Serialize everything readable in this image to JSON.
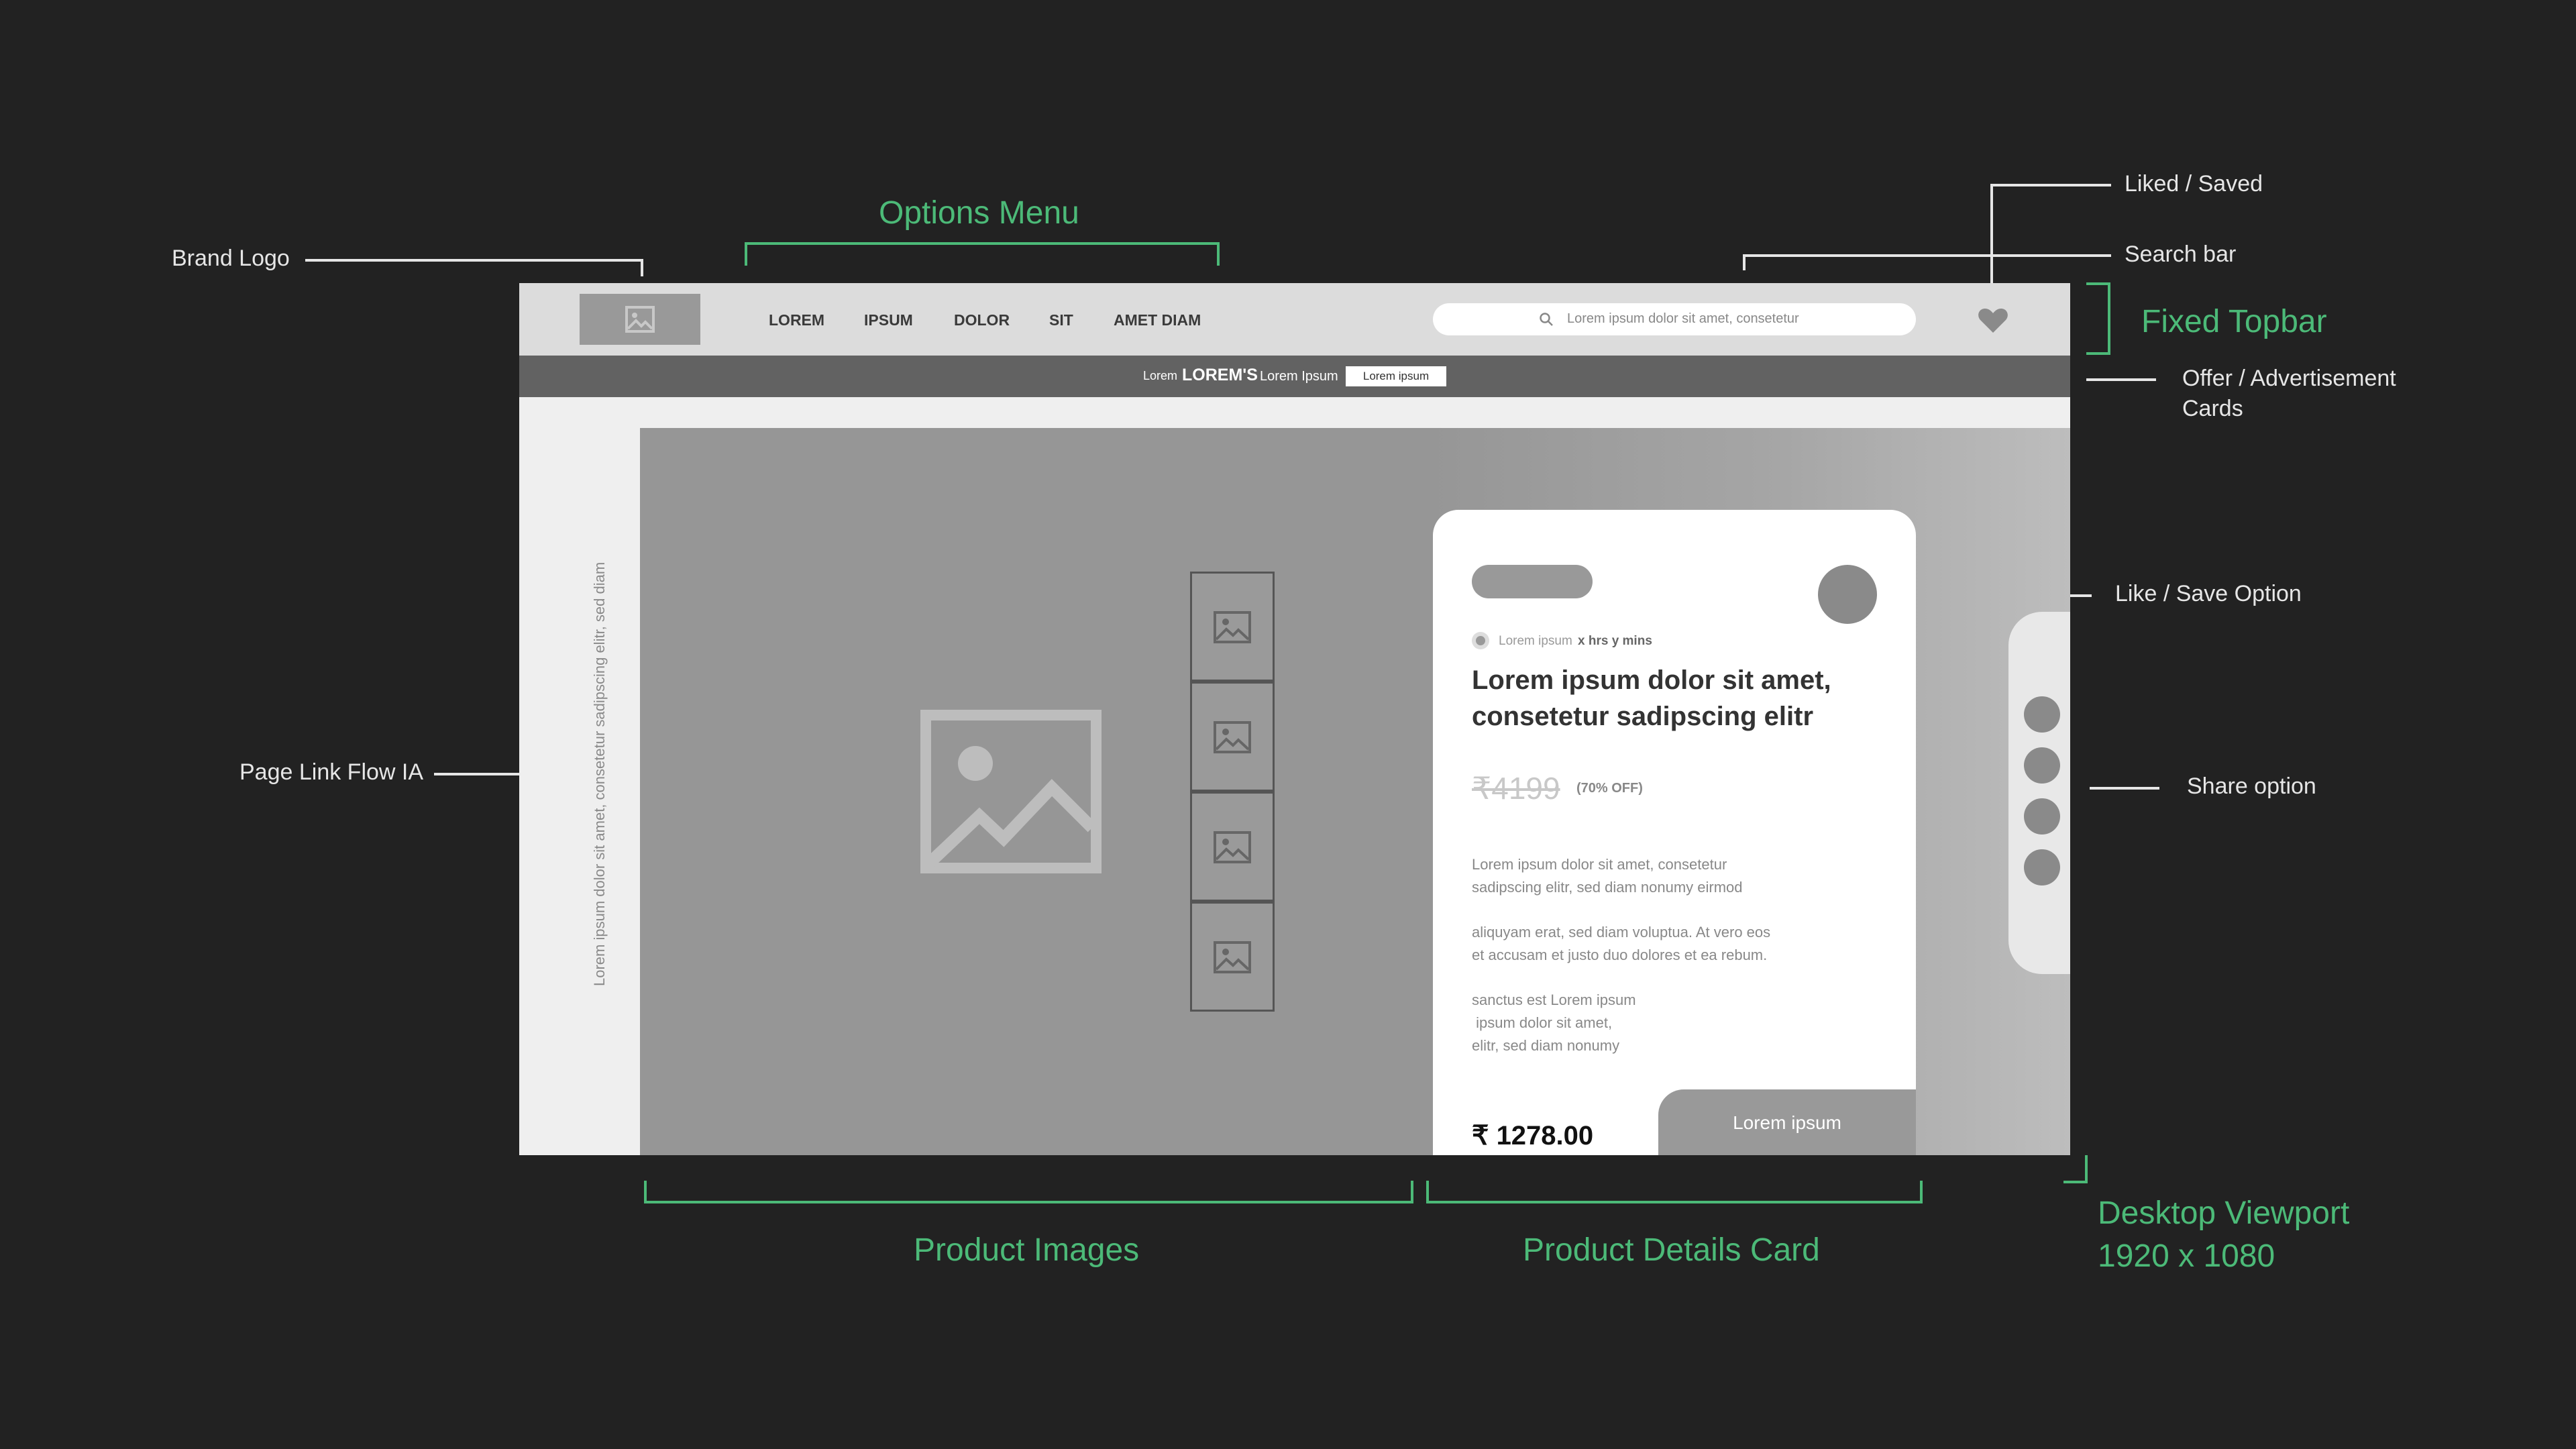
{
  "annotations": {
    "brand_logo": "Brand Logo",
    "options_menu": "Options Menu",
    "liked_saved": "Liked / Saved",
    "search_bar": "Search bar",
    "fixed_topbar": "Fixed Topbar",
    "offer_cards_line1": "Offer / Advertisement",
    "offer_cards_line2": "Cards",
    "like_save_option": "Like / Save Option",
    "page_link_flow": "Page Link Flow IA",
    "share_option": "Share option",
    "product_images": "Product Images",
    "product_details_card": "Product Details Card",
    "viewport_line1": "Desktop Viewport",
    "viewport_line2": "1920 x 1080"
  },
  "topbar": {
    "nav": [
      "LOREM",
      "IPSUM",
      "DOLOR",
      "SIT",
      "AMET DIAM"
    ],
    "search_placeholder": "Lorem ipsum dolor sit amet, consetetur"
  },
  "offer_bar": {
    "pre": "Lorem",
    "brand": "LOREM'S",
    "post": "Lorem Ipsum",
    "button": "Lorem ipsum"
  },
  "sidebar": {
    "vertical_text": "Lorem ipsum dolor sit amet, consetetur sadipscing elitr, sed diam"
  },
  "card": {
    "timer_label": "Lorem ipsum",
    "timer_value": "x hrs y mins",
    "title_line1": "Lorem ipsum dolor sit amet,",
    "title_line2": "consetetur sadipscing elitr",
    "old_price": "₹4199",
    "discount": "(70% OFF)",
    "desc1_line1": "Lorem ipsum dolor sit amet, consetetur",
    "desc1_line2": "sadipscing elitr, sed diam nonumy eirmod",
    "desc2_line1": "aliquyam erat, sed diam voluptua. At vero eos",
    "desc2_line2": "et accusam et justo duo dolores et ea rebum.",
    "desc3_line1": "sanctus est Lorem ipsum",
    "desc3_line2": " ipsum dolor sit amet,",
    "desc3_line3": "elitr, sed diam nonumy",
    "price": "₹ 1278.00",
    "cta": "Lorem ipsum"
  },
  "colors": {
    "background": "#222222",
    "accent_green": "#4cba78",
    "topbar": "#dcdcdc",
    "offer_bar": "#626262",
    "hero": "#999999"
  },
  "icons": [
    "image-placeholder-icon",
    "search-icon",
    "heart-icon"
  ]
}
